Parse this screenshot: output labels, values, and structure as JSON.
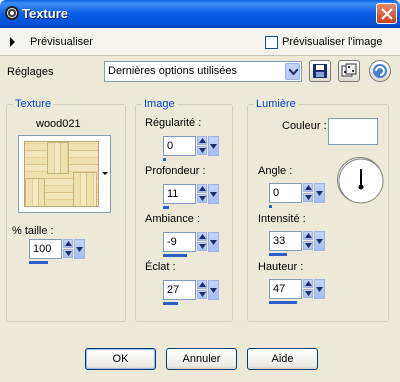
{
  "window": {
    "title": "Texture"
  },
  "preview": {
    "label": "Prévisualiser",
    "checkbox_label": "Prévisualiser l'image",
    "checked": false
  },
  "presets": {
    "label": "Réglages",
    "value": "Dernières options utilisées"
  },
  "texture": {
    "group_title": "Texture",
    "name": "wood021",
    "size_label": "% taille :",
    "size_value": "100",
    "size_fraction": 0.35
  },
  "image": {
    "group_title": "Image",
    "fields": [
      {
        "label": "Régularité :",
        "value": "0",
        "fraction": 0.02
      },
      {
        "label": "Profondeur :",
        "value": "11",
        "fraction": 0.12
      },
      {
        "label": "Ambiance :",
        "value": "-9",
        "fraction": 0.45
      },
      {
        "label": "Éclat :",
        "value": "27",
        "fraction": 0.27
      }
    ]
  },
  "light": {
    "group_title": "Lumière",
    "color_label": "Couleur :",
    "color_value": "#ffffff",
    "fields": [
      {
        "label": "Angle :",
        "value": "0",
        "fraction": 0.01
      },
      {
        "label": "Intensité :",
        "value": "33",
        "fraction": 0.33
      },
      {
        "label": "Hauteur :",
        "value": "47",
        "fraction": 0.52
      }
    ]
  },
  "buttons": {
    "ok": "OK",
    "cancel": "Annuler",
    "help": "Aide"
  },
  "colors": {
    "accent": "#0046d5",
    "window_bg": "#ece9d8",
    "titlebar": "#0a5ce6"
  }
}
